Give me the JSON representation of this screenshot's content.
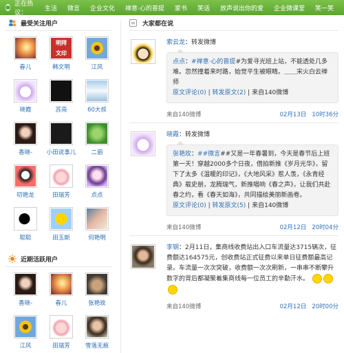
{
  "topbar": {
    "hot_label": "正在热议：",
    "items": [
      "生活",
      "微言",
      "企业文化",
      "禅意·心的普提",
      "家书",
      "笑话",
      "放声说出你的爱",
      "企业微课堂",
      "笑一笑"
    ]
  },
  "left": {
    "follow_title": "最受关注用户",
    "follow_users": [
      "春儿",
      "韩文明",
      "江风",
      "晓霞",
      "苏亮",
      "60大叔",
      "香晓-",
      "小田说事儿",
      "二丽",
      "叨艳龙",
      "田瑞芳",
      "点点",
      "聪聪",
      "田玉斯",
      "何艳明"
    ],
    "active_title": "近期活跃用户",
    "active_users": [
      "香晓-",
      "春儿",
      "张艳玫",
      "江风",
      "田瑞芳",
      "雪落无痕"
    ]
  },
  "feed": {
    "title": "大家都在说",
    "posts": [
      {
        "author": "索云龙",
        "action": "：转发微博",
        "quote_author": "点点",
        "quote_tag": "#禅意·心的普提",
        "quote_text": "#为爱寻光班上站，不能透处几多难。忽然撞着来时路，始觉平生被眼睛。＿＿宋火白云禅师",
        "quote_links": [
          "原文评论(0)",
          "转发原文(2)"
        ],
        "quote_source": "来自140微博",
        "source": "来自140微博",
        "date": "02月13日",
        "time": "10时36分"
      },
      {
        "author": "晓霞",
        "action": "：转发微博",
        "quote_author": "张艳玫",
        "quote_tag": "##微言",
        "quote_text": "##又是一年春暑到，今天是春节后上班第一天！穿越2000多个日夜，借拍新推《岁月光华》，留下了太多《温暖的印记》，《大地风采》惹人羡，《永青经典》载史册，龙腾瑞气，新推唱响《春之声》，让我们共赴春之约，看《春天如海》，共同描绘美丽新画卷。",
        "quote_links": [
          "原文评论(0)",
          "转发原文(5)"
        ],
        "quote_source": "来自140微博",
        "source": "来自140微博",
        "date": "02月12日",
        "time": "20时04分"
      },
      {
        "author": "李钢",
        "text": "：2月11日，集商线收费站出入口车流量达3715辆次，征费额达164575元，创收费站正式征费以来单日征费额最高记录。车流量一次次突破，收费额一次次刷新，一串串不断攀升数字的背后都凝聚着集商线每一位员工的辛勤汗水。",
        "source": "来自140微博",
        "date": "02月12日",
        "time": "20时00分"
      }
    ]
  }
}
